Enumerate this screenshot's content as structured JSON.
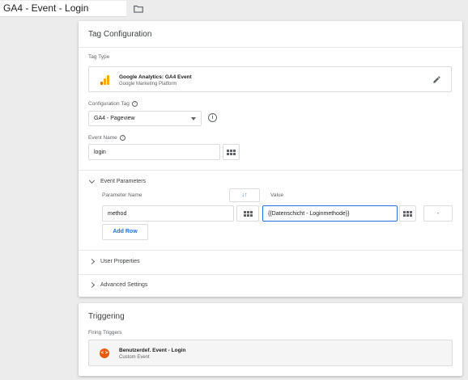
{
  "header": {
    "tag_name": "GA4 - Event - Login",
    "folder_icon": "folder-icon"
  },
  "config": {
    "section_title": "Tag Configuration",
    "tag_type_label": "Tag Type",
    "tag_type_name": "Google Analytics: GA4 Event",
    "tag_type_vendor": "Google Marketing Platform",
    "config_tag_label": "Configuration Tag",
    "config_tag_value": "GA4 - Pageview",
    "event_name_label": "Event Name",
    "event_name_value": "login",
    "event_params": {
      "title": "Event Parameters",
      "col_name": "Parameter Name",
      "col_value": "Value",
      "rows": [
        {
          "name": "method",
          "value": "{{Datenschicht - Loginmethode}}"
        }
      ],
      "remove_label": "-",
      "add_row_label": "Add Row"
    },
    "user_properties_label": "User Properties",
    "advanced_settings_label": "Advanced Settings"
  },
  "triggering": {
    "section_title": "Triggering",
    "firing_label": "Firing Triggers",
    "trigger_name": "Benutzerdef. Event - Login",
    "trigger_type": "Custom Event"
  },
  "colors": {
    "accent": "#1a73e8",
    "ga_orange": "#f9ab00",
    "ga_dark_orange": "#e37400",
    "trigger_orange": "#e8590c"
  },
  "icons": {
    "help": "?",
    "info": "i",
    "sort": "↓↑",
    "trigger": "< >"
  }
}
